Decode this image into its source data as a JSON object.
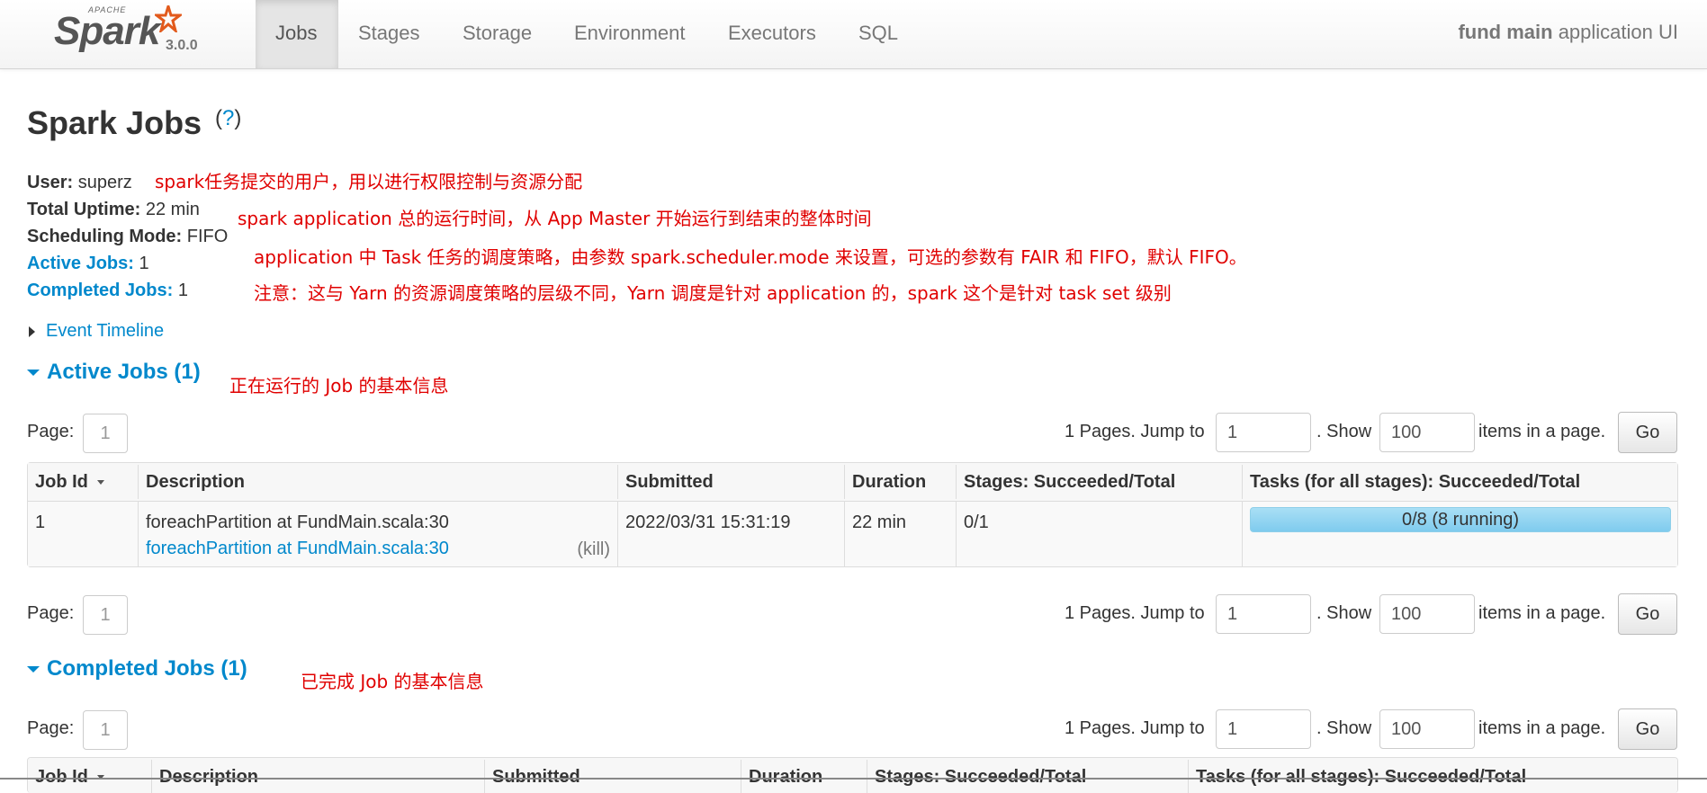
{
  "navbar": {
    "brand_apache": "APACHE",
    "brand_name": "Spark",
    "version": "3.0.0",
    "tabs": [
      {
        "label": "Jobs",
        "active": true
      },
      {
        "label": "Stages"
      },
      {
        "label": "Storage"
      },
      {
        "label": "Environment"
      },
      {
        "label": "Executors"
      },
      {
        "label": "SQL"
      }
    ],
    "app_name_bold": "fund main",
    "app_name_rest": " application UI"
  },
  "page": {
    "title": "Spark Jobs",
    "help": "?"
  },
  "summary": {
    "user_label": "User:",
    "user_value": "superz",
    "uptime_label": "Total Uptime:",
    "uptime_value": "22 min",
    "sched_label": "Scheduling Mode:",
    "sched_value": "FIFO",
    "active_label": "Active Jobs:",
    "active_value": "1",
    "completed_label": "Completed Jobs:",
    "completed_value": "1"
  },
  "annotations": {
    "user": "spark任务提交的用户，用以进行权限控制与资源分配",
    "uptime": "spark application 总的运行时间，从 App Master 开始运行到结束的整体时间",
    "sched1": "application 中 Task 任务的调度策略，由参数 spark.scheduler.mode 来设置，可选的参数有 FAIR 和 FIFO，默认 FIFO。",
    "sched2": "注意：这与 Yarn 的资源调度策略的层级不同，Yarn 调度是针对 application 的，spark 这个是针对 task set 级别",
    "active": "正在运行的 Job 的基本信息",
    "completed": "已完成 Job 的基本信息"
  },
  "event_timeline": "Event Timeline",
  "active_section": "Active Jobs (1)",
  "completed_section": "Completed Jobs (1)",
  "paging": {
    "page_label": "Page:",
    "page_value": "1",
    "pages_text": "1 Pages. Jump to",
    "jump_value": "1",
    "show_text": ". Show",
    "show_value": "100",
    "items_text": "items in a page.",
    "go_label": "Go"
  },
  "active_table": {
    "headers": [
      "Job Id",
      "Description",
      "Submitted",
      "Duration",
      "Stages: Succeeded/Total",
      "Tasks (for all stages): Succeeded/Total"
    ],
    "rows": [
      {
        "job_id": "1",
        "desc_line1": "foreachPartition at FundMain.scala:30",
        "desc_link": "foreachPartition at FundMain.scala:30",
        "kill": "(kill)",
        "submitted": "2022/03/31 15:31:19",
        "duration": "22 min",
        "stages": "0/1",
        "tasks": "0/8 (8 running)",
        "tasks_progress": 0
      }
    ]
  },
  "completed_table": {
    "headers": [
      "Job Id",
      "Description",
      "Submitted",
      "Duration",
      "Stages: Succeeded/Total",
      "Tasks (for all stages): Succeeded/Total"
    ]
  }
}
